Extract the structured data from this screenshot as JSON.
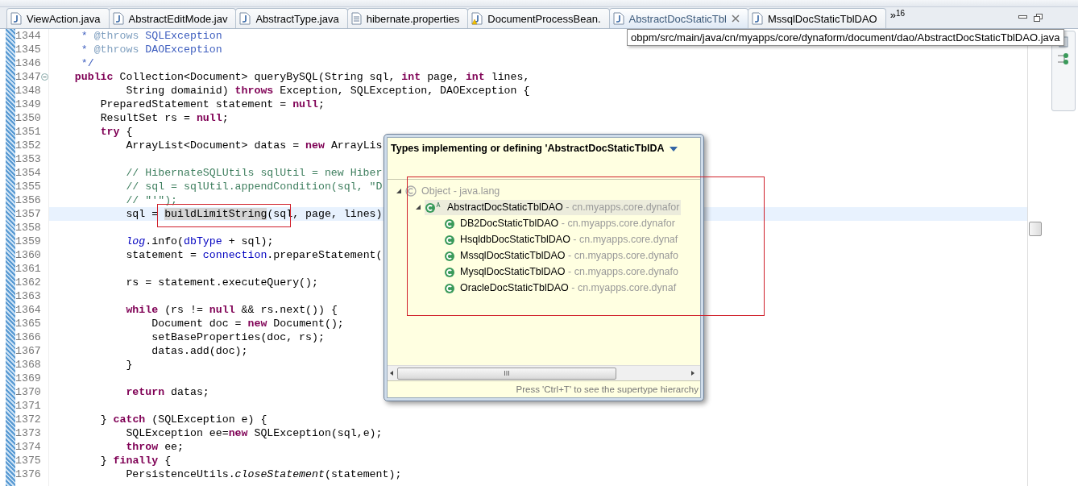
{
  "tabs": [
    {
      "label": "ViewAction.java",
      "kind": "java",
      "selected": false,
      "closable": false
    },
    {
      "label": "AbstractEditMode.jav",
      "kind": "java",
      "selected": false,
      "closable": false
    },
    {
      "label": "AbstractType.java",
      "kind": "java",
      "selected": false,
      "closable": false
    },
    {
      "label": "hibernate.properties",
      "kind": "properties",
      "selected": false,
      "closable": false
    },
    {
      "label": "DocumentProcessBean.",
      "kind": "java_warning",
      "selected": false,
      "closable": false
    },
    {
      "label": "AbstractDocStaticTbl",
      "kind": "java",
      "selected": true,
      "closable": true
    },
    {
      "label": "MssqlDocStaticTblDAO",
      "kind": "java",
      "selected": false,
      "closable": false
    }
  ],
  "tab_overflow": {
    "glyph": "»",
    "count": "16"
  },
  "tooltip": "obpm/src/main/java/cn/myapps/core/dynaform/document/dao/AbstractDocStaticTblDAO.java",
  "editor": {
    "lines": [
      {
        "number": "1344",
        "tokens": [
          {
            "kind": "doc",
            "text": "     * "
          },
          {
            "kind": "doc_tag",
            "text": "@throws"
          },
          {
            "kind": "doc",
            "text": " SQLException"
          }
        ]
      },
      {
        "number": "1345",
        "tokens": [
          {
            "kind": "doc",
            "text": "     * "
          },
          {
            "kind": "doc_tag",
            "text": "@throws"
          },
          {
            "kind": "doc",
            "text": " DAOException"
          }
        ]
      },
      {
        "number": "1346",
        "tokens": [
          {
            "kind": "doc",
            "text": "     */"
          }
        ]
      },
      {
        "number": "1347",
        "fold": true,
        "tokens": [
          {
            "kind": "keyword",
            "text": "    public"
          },
          {
            "kind": "plain",
            "text": " Collection<Document> queryBySQL(String sql, "
          },
          {
            "kind": "keyword",
            "text": "int"
          },
          {
            "kind": "plain",
            "text": " page, "
          },
          {
            "kind": "keyword",
            "text": "int"
          },
          {
            "kind": "plain",
            "text": " lines,"
          }
        ]
      },
      {
        "number": "1348",
        "tokens": [
          {
            "kind": "plain",
            "text": "            String domainid) "
          },
          {
            "kind": "keyword",
            "text": "throws"
          },
          {
            "kind": "plain",
            "text": " Exception, SQLException, DAOException {"
          }
        ]
      },
      {
        "number": "1349",
        "tokens": [
          {
            "kind": "plain",
            "text": "        PreparedStatement statement = "
          },
          {
            "kind": "keyword",
            "text": "null"
          },
          {
            "kind": "plain",
            "text": ";"
          }
        ]
      },
      {
        "number": "1350",
        "tokens": [
          {
            "kind": "plain",
            "text": "        ResultSet rs = "
          },
          {
            "kind": "keyword",
            "text": "null"
          },
          {
            "kind": "plain",
            "text": ";"
          }
        ]
      },
      {
        "number": "1351",
        "tokens": [
          {
            "kind": "keyword",
            "text": "        try"
          },
          {
            "kind": "plain",
            "text": " {"
          }
        ]
      },
      {
        "number": "1352",
        "tokens": [
          {
            "kind": "plain",
            "text": "            ArrayList<Document> datas = "
          },
          {
            "kind": "keyword",
            "text": "new"
          },
          {
            "kind": "plain",
            "text": " ArrayLis"
          }
        ]
      },
      {
        "number": "1353"
      },
      {
        "number": "1354",
        "tokens": [
          {
            "kind": "comment",
            "text": "            // HibernateSQLUtils sqlUtil = new Hiber"
          }
        ]
      },
      {
        "number": "1355",
        "tokens": [
          {
            "kind": "comment",
            "text": "            // sql = sqlUtil.appendCondition(sql, \"D"
          }
        ]
      },
      {
        "number": "1356",
        "tokens": [
          {
            "kind": "comment",
            "text": "            // \"'\");"
          }
        ]
      },
      {
        "number": "1357",
        "current": true,
        "tokens": [
          {
            "kind": "plain",
            "text": "            sql = "
          },
          {
            "kind": "occurrence",
            "text": "buildLimitString"
          },
          {
            "kind": "plain",
            "text": "(sql, page, lines)"
          }
        ]
      },
      {
        "number": "1358"
      },
      {
        "number": "1359",
        "tokens": [
          {
            "kind": "static_field",
            "text": "            log"
          },
          {
            "kind": "plain",
            "text": ".info("
          },
          {
            "kind": "field",
            "text": "dbType"
          },
          {
            "kind": "plain",
            "text": " + sql);"
          }
        ]
      },
      {
        "number": "1360",
        "tokens": [
          {
            "kind": "plain",
            "text": "            statement = "
          },
          {
            "kind": "field",
            "text": "connection"
          },
          {
            "kind": "plain",
            "text": ".prepareStatement("
          }
        ]
      },
      {
        "number": "1361"
      },
      {
        "number": "1362",
        "tokens": [
          {
            "kind": "plain",
            "text": "            rs = statement.executeQuery();"
          }
        ]
      },
      {
        "number": "1363"
      },
      {
        "number": "1364",
        "tokens": [
          {
            "kind": "keyword",
            "text": "            while"
          },
          {
            "kind": "plain",
            "text": " (rs != "
          },
          {
            "kind": "keyword",
            "text": "null"
          },
          {
            "kind": "plain",
            "text": " && rs.next()) {"
          }
        ]
      },
      {
        "number": "1365",
        "tokens": [
          {
            "kind": "plain",
            "text": "                Document doc = "
          },
          {
            "kind": "keyword",
            "text": "new"
          },
          {
            "kind": "plain",
            "text": " Document();"
          }
        ]
      },
      {
        "number": "1366",
        "tokens": [
          {
            "kind": "plain",
            "text": "                setBaseProperties(doc, rs);"
          }
        ]
      },
      {
        "number": "1367",
        "tokens": [
          {
            "kind": "plain",
            "text": "                datas.add(doc);"
          }
        ]
      },
      {
        "number": "1368",
        "tokens": [
          {
            "kind": "plain",
            "text": "            }"
          }
        ]
      },
      {
        "number": "1369"
      },
      {
        "number": "1370",
        "tokens": [
          {
            "kind": "keyword",
            "text": "            return"
          },
          {
            "kind": "plain",
            "text": " datas;"
          }
        ]
      },
      {
        "number": "1371"
      },
      {
        "number": "1372",
        "tokens": [
          {
            "kind": "plain",
            "text": "        } "
          },
          {
            "kind": "keyword",
            "text": "catch"
          },
          {
            "kind": "plain",
            "text": " (SQLException e) {"
          }
        ]
      },
      {
        "number": "1373",
        "tokens": [
          {
            "kind": "plain",
            "text": "            SQLException ee="
          },
          {
            "kind": "keyword",
            "text": "new"
          },
          {
            "kind": "plain",
            "text": " SQLException(sql,e);"
          }
        ]
      },
      {
        "number": "1374",
        "tokens": [
          {
            "kind": "keyword",
            "text": "            throw"
          },
          {
            "kind": "plain",
            "text": " ee;"
          }
        ]
      },
      {
        "number": "1375",
        "tokens": [
          {
            "kind": "plain",
            "text": "        } "
          },
          {
            "kind": "keyword",
            "text": "finally"
          },
          {
            "kind": "plain",
            "text": " {"
          }
        ]
      },
      {
        "number": "1376",
        "tokens": [
          {
            "kind": "plain",
            "text": "            PersistenceUtils."
          },
          {
            "kind": "italic",
            "text": "closeStatement"
          },
          {
            "kind": "plain",
            "text": "(statement);"
          }
        ]
      }
    ]
  },
  "hierarchy_popup": {
    "title": "Types implementing or defining 'AbstractDocStaticTblDA",
    "tree": [
      {
        "name": "Object",
        "separator": "-",
        "package": "java.lang",
        "kind": "object",
        "expanded": true,
        "selected": false,
        "children": [
          {
            "name": "AbstractDocStaticTblDAO",
            "separator": "-",
            "package": "cn.myapps.core.dynafor",
            "kind": "abstract_class",
            "expanded": true,
            "selected": true,
            "children": [
              {
                "name": "DB2DocStaticTblDAO",
                "separator": "-",
                "package": "cn.myapps.core.dynafor",
                "kind": "class",
                "selected": false
              },
              {
                "name": "HsqldbDocStaticTblDAO",
                "separator": "-",
                "package": "cn.myapps.core.dynaf",
                "kind": "class",
                "selected": false
              },
              {
                "name": "MssqlDocStaticTblDAO",
                "separator": "-",
                "package": "cn.myapps.core.dynafo",
                "kind": "class",
                "selected": false
              },
              {
                "name": "MysqlDocStaticTblDAO",
                "separator": "-",
                "package": "cn.myapps.core.dynafo",
                "kind": "class",
                "selected": false
              },
              {
                "name": "OracleDocStaticTblDAO",
                "separator": "-",
                "package": "cn.myapps.core.dynaf",
                "kind": "class",
                "selected": false
              }
            ]
          }
        ]
      }
    ],
    "scroll_grip": "III",
    "footer": "Press 'Ctrl+T' to see the supertype hierarchy"
  }
}
